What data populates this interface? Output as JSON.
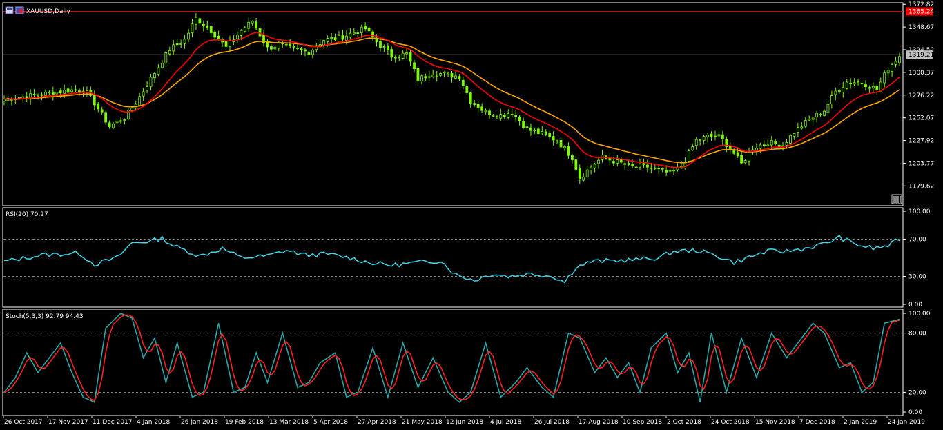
{
  "window": {
    "symbol_label": "XAUUSD,Daily"
  },
  "colors": {
    "background": "#000000",
    "frame": "#ffffff",
    "bull_candle": "#7cfc00",
    "ma_fast": "#ff0000",
    "ma_slow": "#ffa500",
    "rsi_line": "#3fd7e8",
    "stoch_main": "#2aa6a6",
    "stoch_signal": "#ff2020",
    "price_line_red": "#ff0000",
    "bid_line": "#808080"
  },
  "chart_data": [
    {
      "type": "candlestick",
      "panel": "price",
      "ylim": [
        1160,
        1373
      ],
      "y_ticks": [
        "1372.82",
        "1348.67",
        "1324.52",
        "1300.37",
        "1276.22",
        "1252.07",
        "1227.92",
        "1203.77",
        "1179.62"
      ],
      "current_price": "1319.21",
      "high_line_price": "1365.24",
      "ma_fast_name": "",
      "ma_slow_name": "",
      "anchors": [
        [
          0,
          1272
        ],
        [
          8,
          1276
        ],
        [
          15,
          1280
        ],
        [
          21,
          1283
        ],
        [
          24,
          1268
        ],
        [
          28,
          1243
        ],
        [
          32,
          1252
        ],
        [
          35,
          1268
        ],
        [
          40,
          1300
        ],
        [
          44,
          1325
        ],
        [
          48,
          1335
        ],
        [
          51,
          1358
        ],
        [
          55,
          1345
        ],
        [
          59,
          1327
        ],
        [
          63,
          1345
        ],
        [
          66,
          1355
        ],
        [
          70,
          1326
        ],
        [
          73,
          1330
        ],
        [
          77,
          1325
        ],
        [
          81,
          1322
        ],
        [
          85,
          1335
        ],
        [
          89,
          1337
        ],
        [
          93,
          1343
        ],
        [
          96,
          1347
        ],
        [
          99,
          1333
        ],
        [
          103,
          1318
        ],
        [
          107,
          1320
        ],
        [
          110,
          1293
        ],
        [
          114,
          1300
        ],
        [
          118,
          1298
        ],
        [
          121,
          1296
        ],
        [
          124,
          1270
        ],
        [
          128,
          1258
        ],
        [
          132,
          1255
        ],
        [
          135,
          1258
        ],
        [
          139,
          1240
        ],
        [
          143,
          1235
        ],
        [
          147,
          1228
        ],
        [
          151,
          1210
        ],
        [
          153,
          1188
        ],
        [
          156,
          1200
        ],
        [
          159,
          1210
        ],
        [
          163,
          1205
        ],
        [
          167,
          1200
        ],
        [
          171,
          1200
        ],
        [
          175,
          1195
        ],
        [
          177,
          1193
        ],
        [
          180,
          1200
        ],
        [
          184,
          1228
        ],
        [
          187,
          1232
        ],
        [
          190,
          1232
        ],
        [
          193,
          1220
        ],
        [
          196,
          1203
        ],
        [
          199,
          1220
        ],
        [
          203,
          1226
        ],
        [
          207,
          1223
        ],
        [
          210,
          1237
        ],
        [
          214,
          1250
        ],
        [
          218,
          1260
        ],
        [
          221,
          1280
        ],
        [
          224,
          1290
        ],
        [
          228,
          1290
        ],
        [
          232,
          1282
        ],
        [
          235,
          1305
        ],
        [
          238,
          1318
        ]
      ],
      "n_bars": 239
    },
    {
      "type": "line",
      "panel": "RSI",
      "label": "RSI(20) 70.27",
      "ylim": [
        0,
        100
      ],
      "levels": [
        30,
        70
      ],
      "y_ticks": [
        "100.00",
        "70.00",
        "30.00",
        "0.00"
      ],
      "anchors": [
        [
          0,
          46
        ],
        [
          10,
          53
        ],
        [
          20,
          55
        ],
        [
          24,
          43
        ],
        [
          30,
          50
        ],
        [
          34,
          66
        ],
        [
          39,
          68
        ],
        [
          42,
          71
        ],
        [
          45,
          63
        ],
        [
          52,
          52
        ],
        [
          58,
          60
        ],
        [
          63,
          50
        ],
        [
          70,
          52
        ],
        [
          75,
          58
        ],
        [
          80,
          53
        ],
        [
          86,
          54
        ],
        [
          92,
          50
        ],
        [
          97,
          45
        ],
        [
          103,
          42
        ],
        [
          110,
          45
        ],
        [
          116,
          47
        ],
        [
          120,
          32
        ],
        [
          125,
          26
        ],
        [
          130,
          33
        ],
        [
          134,
          30
        ],
        [
          140,
          33
        ],
        [
          146,
          30
        ],
        [
          149,
          24
        ],
        [
          152,
          40
        ],
        [
          156,
          46
        ],
        [
          162,
          47
        ],
        [
          168,
          48
        ],
        [
          174,
          50
        ],
        [
          178,
          57
        ],
        [
          184,
          58
        ],
        [
          189,
          53
        ],
        [
          194,
          45
        ],
        [
          199,
          52
        ],
        [
          203,
          57
        ],
        [
          208,
          57
        ],
        [
          214,
          61
        ],
        [
          218,
          65
        ],
        [
          222,
          72
        ],
        [
          226,
          65
        ],
        [
          231,
          60
        ],
        [
          235,
          63
        ],
        [
          238,
          70
        ]
      ]
    },
    {
      "type": "line",
      "panel": "Stochastic",
      "label": "Stoch(5,3,3) 92.79 94.43",
      "ylim": [
        0,
        100
      ],
      "levels": [
        20,
        80
      ],
      "y_ticks": [
        "100.00",
        "80.00",
        "20.00",
        "0.00"
      ],
      "anchors": [
        [
          0,
          20
        ],
        [
          3,
          35
        ],
        [
          6,
          60
        ],
        [
          9,
          40
        ],
        [
          12,
          55
        ],
        [
          15,
          70
        ],
        [
          18,
          40
        ],
        [
          21,
          15
        ],
        [
          24,
          10
        ],
        [
          27,
          85
        ],
        [
          31,
          100
        ],
        [
          34,
          95
        ],
        [
          37,
          55
        ],
        [
          40,
          75
        ],
        [
          43,
          30
        ],
        [
          46,
          70
        ],
        [
          50,
          15
        ],
        [
          53,
          20
        ],
        [
          57,
          90
        ],
        [
          61,
          20
        ],
        [
          64,
          25
        ],
        [
          67,
          60
        ],
        [
          70,
          30
        ],
        [
          74,
          80
        ],
        [
          78,
          25
        ],
        [
          81,
          30
        ],
        [
          84,
          50
        ],
        [
          88,
          60
        ],
        [
          91,
          15
        ],
        [
          94,
          20
        ],
        [
          98,
          65
        ],
        [
          102,
          15
        ],
        [
          106,
          70
        ],
        [
          110,
          25
        ],
        [
          114,
          55
        ],
        [
          118,
          20
        ],
        [
          121,
          10
        ],
        [
          124,
          20
        ],
        [
          128,
          70
        ],
        [
          132,
          15
        ],
        [
          136,
          30
        ],
        [
          139,
          45
        ],
        [
          143,
          25
        ],
        [
          146,
          15
        ],
        [
          150,
          80
        ],
        [
          153,
          75
        ],
        [
          157,
          40
        ],
        [
          160,
          55
        ],
        [
          163,
          35
        ],
        [
          166,
          50
        ],
        [
          169,
          20
        ],
        [
          172,
          65
        ],
        [
          176,
          80
        ],
        [
          179,
          40
        ],
        [
          182,
          60
        ],
        [
          185,
          10
        ],
        [
          188,
          80
        ],
        [
          192,
          20
        ],
        [
          196,
          75
        ],
        [
          200,
          35
        ],
        [
          204,
          80
        ],
        [
          208,
          55
        ],
        [
          212,
          75
        ],
        [
          215,
          90
        ],
        [
          218,
          80
        ],
        [
          222,
          45
        ],
        [
          225,
          50
        ],
        [
          228,
          20
        ],
        [
          231,
          30
        ],
        [
          234,
          90
        ],
        [
          238,
          94
        ]
      ]
    }
  ],
  "x_axis": {
    "labels": [
      "26 Oct 2017",
      "17 Nov 2017",
      "11 Dec 2017",
      "4 Jan 2018",
      "26 Jan 2018",
      "19 Feb 2018",
      "13 Mar 2018",
      "5 Apr 2018",
      "27 Apr 2018",
      "21 May 2018",
      "12 Jun 2018",
      "4 Jul 2018",
      "26 Jul 2018",
      "17 Aug 2018",
      "10 Sep 2018",
      "2 Oct 2018",
      "24 Oct 2018",
      "15 Nov 2018",
      "7 Dec 2018",
      "2 Jan 2019",
      "24 Jan 2019"
    ]
  }
}
